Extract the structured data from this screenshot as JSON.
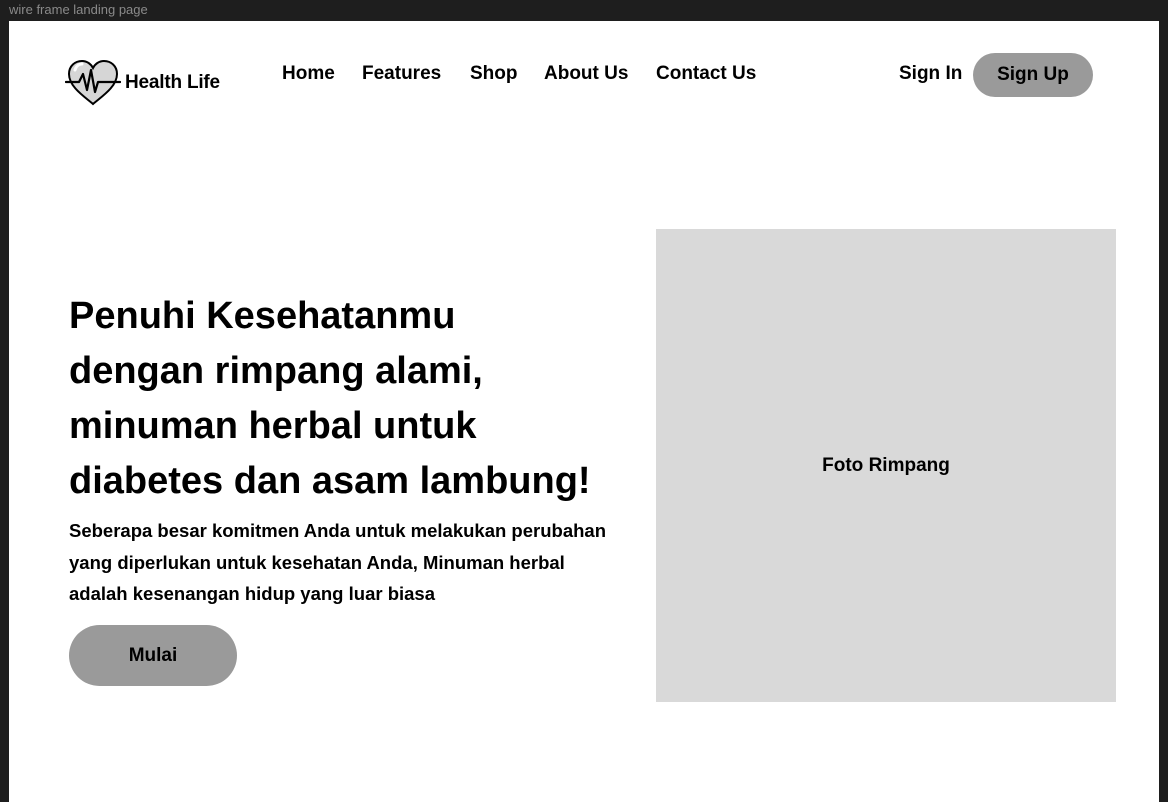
{
  "frame": {
    "label": "wire frame landing page"
  },
  "header": {
    "logo_icon": "heart-pulse-icon",
    "brand": "Health Life",
    "nav_items": [
      {
        "label": "Home"
      },
      {
        "label": "Features"
      },
      {
        "label": "Shop"
      },
      {
        "label": "About Us"
      },
      {
        "label": "Contact Us"
      }
    ],
    "sign_in": "Sign In",
    "sign_up": "Sign Up"
  },
  "hero": {
    "title_lines": [
      "Penuhi Kesehatanmu",
      "dengan rimpang alami,",
      "minuman herbal untuk",
      "diabetes dan asam lambung!"
    ],
    "subtitle_lines": [
      "Seberapa besar komitmen Anda untuk melakukan perubahan",
      "yang diperlukan untuk kesehatan Anda, Minuman herbal",
      "adalah kesenangan hidup yang luar biasa"
    ],
    "cta": "Mulai",
    "image_label": "Foto Rimpang"
  },
  "colors": {
    "frame_background": "#1e1e1e",
    "canvas_background": "#ffffff",
    "button_gray": "#9a9a9a",
    "placeholder_gray": "#d9d9d9",
    "text": "#000000"
  }
}
